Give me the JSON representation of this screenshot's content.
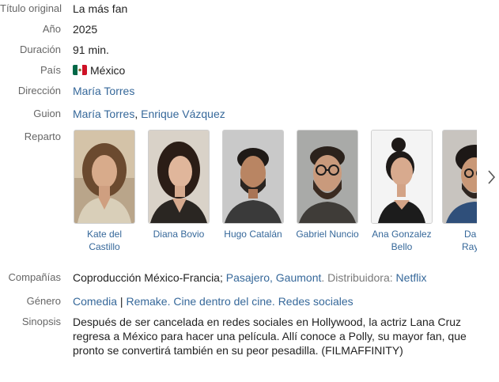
{
  "labels": {
    "titulo": "Título original",
    "anio": "Año",
    "duracion": "Duración",
    "pais": "País",
    "direccion": "Dirección",
    "guion": "Guion",
    "reparto": "Reparto",
    "companias": "Compañías",
    "genero": "Género",
    "sinopsis": "Sinopsis"
  },
  "values": {
    "titulo": "La más fan",
    "anio": "2025",
    "duracion": "91 min.",
    "pais": "México",
    "direccion": "María Torres",
    "guion": [
      "María Torres",
      "Enrique Vázquez"
    ],
    "guion_sep": ",",
    "companias": {
      "prefix": "Coproducción México-Francia;",
      "pasajero": "Pasajero",
      "sep": ",",
      "gaumont": "Gaumont",
      "distrib_label": ". Distribuidora:",
      "netflix": "Netflix"
    },
    "genero": {
      "comedia": "Comedia",
      "pipe": "|",
      "remake": "Remake",
      "cine": "Cine dentro del cine",
      "redes": "Redes sociales",
      "dot": "."
    },
    "sinopsis": [
      "Después de ser cancelada en redes sociales en Hollywood, la actriz Lana Cruz",
      "regresa a México para hacer una película. Allí conoce a Polly, su mayor fan, que",
      "pronto se convertirá también en su peor pesadilla. (FILMAFFINITY)"
    ]
  },
  "cast": [
    {
      "name1": "Kate del",
      "name2": "Castillo",
      "icon": "actor-photo"
    },
    {
      "name1": "Diana Bovio",
      "name2": "",
      "icon": "actor-photo"
    },
    {
      "name1": "Hugo Catalán",
      "name2": "",
      "icon": "actor-photo"
    },
    {
      "name1": "Gabriel Nuncio",
      "name2": "",
      "icon": "actor-photo"
    },
    {
      "name1": "Ana Gonzalez",
      "name2": "Bello",
      "icon": "actor-photo"
    },
    {
      "name1": "Dan",
      "name2": "Rayn",
      "icon": "actor-photo"
    }
  ],
  "colors": {
    "label": "#666666",
    "text": "#222222",
    "link": "#36689a",
    "mexico_green": "#006847",
    "mexico_red": "#ce1126"
  },
  "icons": {
    "flag": "mexico-flag-icon",
    "next": "chevron-right-icon"
  }
}
